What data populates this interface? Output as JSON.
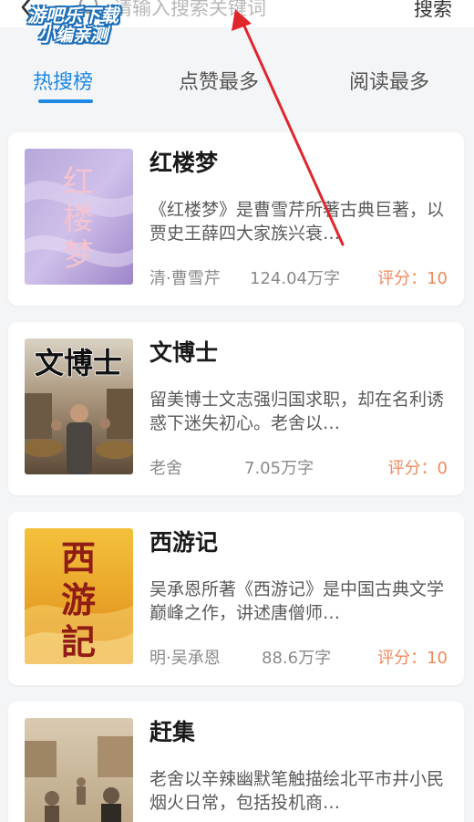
{
  "header": {
    "search_placeholder": "请输入搜索关键词",
    "search_button": "搜索"
  },
  "watermark": {
    "line1": "游吧乐下载",
    "line2": "小编亲测"
  },
  "tabs": [
    {
      "label": "热搜榜",
      "active": true
    },
    {
      "label": "点赞最多",
      "active": false
    },
    {
      "label": "阅读最多",
      "active": false
    }
  ],
  "books": [
    {
      "title": "红楼梦",
      "description": "《红楼梦》是曹雪芹所著古典巨著，以贾史王薛四大家族兴衰…",
      "author": "清·曹雪芹",
      "words": "124.04万字",
      "rating": "评分：10",
      "cover_text": "红楼梦"
    },
    {
      "title": "文博士",
      "description": "留美博士文志强归国求职，却在名利诱惑下迷失初心。老舍以…",
      "author": "老舍",
      "words": "7.05万字",
      "rating": "评分：0",
      "cover_text": "文博士"
    },
    {
      "title": "西游记",
      "description": "吴承恩所著《西游记》是中国古典文学巅峰之作，讲述唐僧师…",
      "author": "明·吴承恩",
      "words": "88.6万字",
      "rating": "评分：10",
      "cover_text": "西游記"
    },
    {
      "title": "赶集",
      "description": "老舍以辛辣幽默笔触描绘北平市井小民烟火日常，包括投机商…",
      "author": "",
      "words": "",
      "rating": "",
      "cover_text": ""
    }
  ],
  "colors": {
    "accent": "#1e88e5",
    "rating": "#f0895a",
    "annotation": "#e0262b"
  },
  "icons": {
    "back": "chevron-left-icon",
    "search": "search-icon"
  }
}
